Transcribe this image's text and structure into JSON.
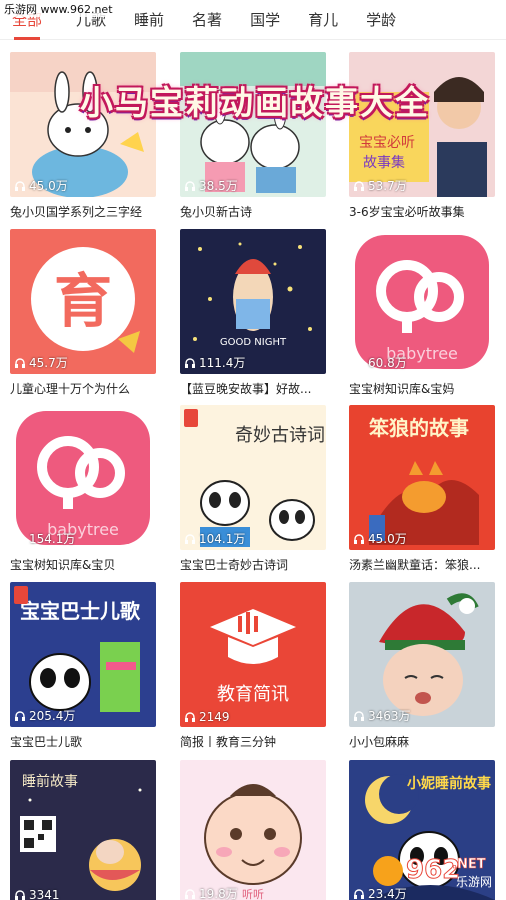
{
  "watermark": "乐游网 www.962.net",
  "tabs": [
    {
      "label": "全部",
      "active": true
    },
    {
      "label": "儿歌",
      "active": false
    },
    {
      "label": "睡前",
      "active": false
    },
    {
      "label": "名著",
      "active": false
    },
    {
      "label": "国学",
      "active": false
    },
    {
      "label": "育儿",
      "active": false
    },
    {
      "label": "学龄",
      "active": false
    }
  ],
  "banner_title": "小马宝莉动画故事大全",
  "accent_color": "#e7473a",
  "albums": [
    {
      "title": "兔小贝国学系列之三字经",
      "plays": "45.0万",
      "icon": "headphones-icon",
      "art": {
        "text": "兔 国"
      }
    },
    {
      "title": "兔小贝新古诗",
      "plays": "38.5万",
      "icon": "headphones-icon",
      "art": {
        "text": "兔小贝新古诗"
      }
    },
    {
      "title": "3-6岁宝宝必听故事集",
      "plays": "53.7万",
      "icon": "headphones-icon",
      "art": {
        "text": "3-6岁宝宝必听故事集"
      }
    },
    {
      "title": "儿童心理十万个为什么",
      "plays": "45.7万",
      "icon": "headphones-icon",
      "art": {
        "text": "育"
      }
    },
    {
      "title": "【蓝豆晚安故事】好故...",
      "plays": "111.4万",
      "icon": "headphones-icon",
      "art": {
        "text": "GOOD NIGHT"
      }
    },
    {
      "title": "宝宝树知识库&宝妈",
      "plays": "60.8万",
      "icon": "headphones-icon",
      "art": {
        "text": "babytree"
      }
    },
    {
      "title": "宝宝树知识库&宝贝",
      "plays": "154.1万",
      "icon": "headphones-icon",
      "art": {
        "text": "babytree"
      }
    },
    {
      "title": "宝宝巴士奇妙古诗词",
      "plays": "104.1万",
      "icon": "headphones-icon",
      "art": {
        "text": "奇妙古诗词"
      }
    },
    {
      "title": "汤素兰幽默童话：笨狼...",
      "plays": "45.0万",
      "icon": "headphones-icon",
      "art": {
        "text": "笨狼的故事"
      }
    },
    {
      "title": "宝宝巴士儿歌",
      "plays": "205.4万",
      "icon": "headphones-icon",
      "art": {
        "text": "宝宝巴士儿歌"
      }
    },
    {
      "title": "简报丨教育三分钟",
      "plays": "2149",
      "icon": "headphones-icon",
      "art": {
        "text": "教育简讯"
      }
    },
    {
      "title": "小小包麻麻",
      "plays": "3463万",
      "icon": "headphones-icon",
      "art": {
        "text": ""
      }
    },
    {
      "title": "",
      "plays": "3341",
      "icon": "headphones-icon",
      "art": {
        "text": "睡前故事"
      }
    },
    {
      "title": "",
      "plays": "19.8万",
      "icon": "headphones-icon",
      "art": {
        "text": "听听"
      }
    },
    {
      "title": "",
      "plays": "23.4万",
      "icon": "headphones-icon",
      "art": {
        "text": "小妮睡前故事"
      }
    }
  ],
  "logo": {
    "big": "962",
    "small": ".NET",
    "sub": "乐游网"
  }
}
